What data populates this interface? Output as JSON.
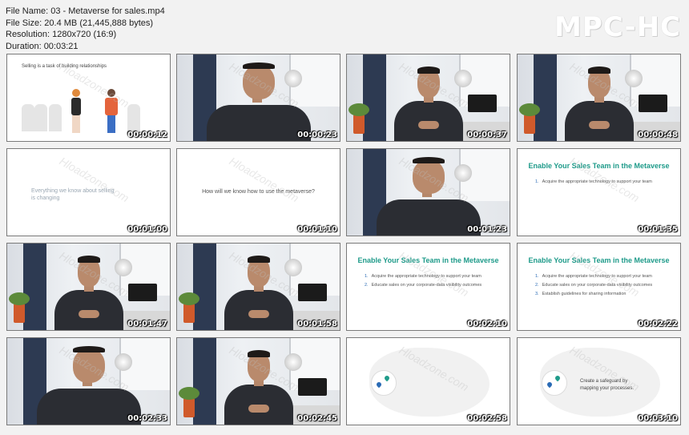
{
  "file_info": {
    "name": "File Name: 03 - Metaverse for sales.mp4",
    "size": "File Size: 20.4 MB (21,445,888 bytes)",
    "resolution": "Resolution: 1280x720 (16:9)",
    "duration": "Duration: 00:03:21"
  },
  "brand": "MPC-HC",
  "watermark": "Hloadzone.com",
  "thumbnails": [
    {
      "time": "00:00:12",
      "kind": "illustration",
      "text": "Selling is a task of building relationships"
    },
    {
      "time": "00:00:23",
      "kind": "presenter-close"
    },
    {
      "time": "00:00:37",
      "kind": "presenter"
    },
    {
      "time": "00:00:48",
      "kind": "presenter"
    },
    {
      "time": "00:01:00",
      "kind": "faded",
      "text": "Everything we know about selling is changing"
    },
    {
      "time": "00:01:10",
      "kind": "question",
      "text": "How will we know how to use the metaverse?"
    },
    {
      "time": "00:01:23",
      "kind": "presenter-close"
    },
    {
      "time": "00:01:35",
      "kind": "slide",
      "title": "Enable Your Sales Team in the Metaverse",
      "bullets": [
        "Acquire the appropriate technology to support your team"
      ]
    },
    {
      "time": "00:01:47",
      "kind": "presenter"
    },
    {
      "time": "00:01:58",
      "kind": "presenter"
    },
    {
      "time": "00:02:10",
      "kind": "slide",
      "title": "Enable Your Sales Team in the Metaverse",
      "bullets": [
        "Acquire the appropriate technology to support your team",
        "Educate sales on your corporate-data visibility outcomes"
      ]
    },
    {
      "time": "00:02:22",
      "kind": "slide",
      "title": "Enable Your Sales Team in the Metaverse",
      "bullets": [
        "Acquire the appropriate technology to support your team",
        "Educate sales on your corporate-data visibility outcomes",
        "Establish guidelines for sharing information"
      ]
    },
    {
      "time": "00:02:33",
      "kind": "presenter-close"
    },
    {
      "time": "00:02:45",
      "kind": "presenter"
    },
    {
      "time": "00:02:58",
      "kind": "map"
    },
    {
      "time": "00:03:10",
      "kind": "map-text",
      "text": "Create a safeguard by mapping your processes."
    }
  ],
  "colors": {
    "accent_teal": "#1f9b8a",
    "bullet_number": "#2a6bb5",
    "background": "#f2f2f2"
  }
}
